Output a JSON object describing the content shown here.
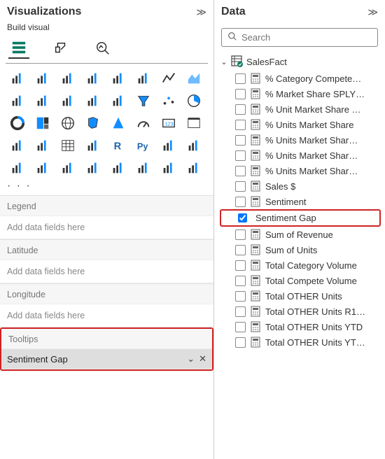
{
  "viz": {
    "title": "Visualizations",
    "subtitle": "Build visual",
    "more": "· · ·",
    "icons": [
      "stacked-bar",
      "stacked-column",
      "clustered-bar",
      "clustered-column",
      "100-stacked-bar",
      "100-stacked-column",
      "line",
      "area",
      "stacked-area",
      "line-stacked-column",
      "line-clustered-column",
      "ribbon",
      "waterfall",
      "funnel",
      "scatter",
      "pie",
      "donut",
      "treemap",
      "map",
      "filled-map",
      "azure-map",
      "gauge",
      "card",
      "kpi",
      "multi-row-card",
      "slicer",
      "table",
      "matrix",
      "r-visual",
      "python-visual",
      "key-influencers",
      "decomposition-tree",
      "qa",
      "narrative",
      "paginated",
      "scorecard",
      "power-apps",
      "power-automate",
      "get-visuals",
      "blank"
    ],
    "wells": [
      {
        "label": "Legend",
        "placeholder": "Add data fields here",
        "value": null
      },
      {
        "label": "Latitude",
        "placeholder": "Add data fields here",
        "value": null
      },
      {
        "label": "Longitude",
        "placeholder": "Add data fields here",
        "value": null
      },
      {
        "label": "Tooltips",
        "placeholder": "Add data fields here",
        "value": "Sentiment Gap",
        "highlight": true
      }
    ]
  },
  "data": {
    "title": "Data",
    "search_placeholder": "Search",
    "table": {
      "name": "SalesFact",
      "expanded": true,
      "fields": [
        {
          "name": "% Category Compete…",
          "checked": false
        },
        {
          "name": "% Market Share SPLY…",
          "checked": false
        },
        {
          "name": "% Unit Market Share …",
          "checked": false
        },
        {
          "name": "% Units Market Share",
          "checked": false
        },
        {
          "name": "% Units Market Shar…",
          "checked": false
        },
        {
          "name": "% Units Market Shar…",
          "checked": false
        },
        {
          "name": "% Units Market Shar…",
          "checked": false
        },
        {
          "name": "Sales $",
          "checked": false
        },
        {
          "name": "Sentiment",
          "checked": false
        },
        {
          "name": "Sentiment Gap",
          "checked": true,
          "highlight": true
        },
        {
          "name": "Sum of Revenue",
          "checked": false
        },
        {
          "name": "Sum of Units",
          "checked": false
        },
        {
          "name": "Total Category Volume",
          "checked": false
        },
        {
          "name": "Total Compete Volume",
          "checked": false
        },
        {
          "name": "Total OTHER Units",
          "checked": false
        },
        {
          "name": "Total OTHER Units R1…",
          "checked": false
        },
        {
          "name": "Total OTHER Units YTD",
          "checked": false
        },
        {
          "name": "Total OTHER Units YT…",
          "checked": false
        }
      ]
    }
  }
}
